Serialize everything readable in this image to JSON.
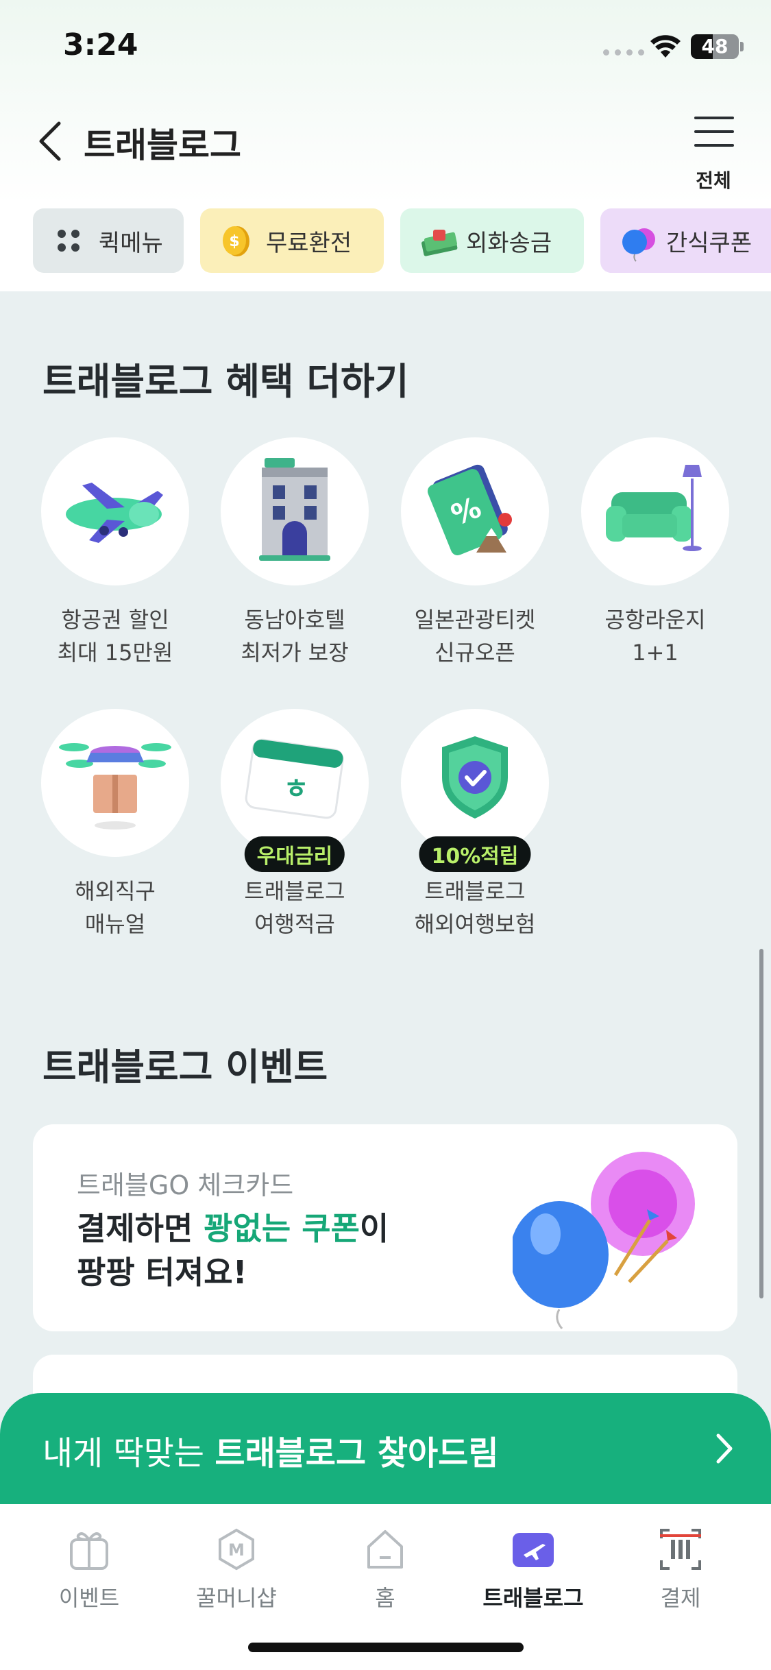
{
  "status_bar": {
    "time": "3:24",
    "battery": "48"
  },
  "header": {
    "title": "트래블로그",
    "menu_label": "전체"
  },
  "quick_menu": [
    {
      "label": "퀵메뉴",
      "icon": "dots-grid-icon"
    },
    {
      "label": "무료환전",
      "icon": "coin-icon"
    },
    {
      "label": "외화송금",
      "icon": "money-stack-icon"
    },
    {
      "label": "간식쿠폰",
      "icon": "balloon-icon"
    }
  ],
  "benefits": {
    "title": "트래블로그 혜택 더하기",
    "items": [
      {
        "line1": "항공권 할인",
        "line2": "최대 15만원",
        "icon": "airplane-icon",
        "badge": ""
      },
      {
        "line1": "동남아호텔",
        "line2": "최저가 보장",
        "icon": "hotel-icon",
        "badge": ""
      },
      {
        "line1": "일본관광티켓",
        "line2": "신규오픈",
        "icon": "ticket-icon",
        "badge": ""
      },
      {
        "line1": "공항라운지",
        "line2": "1+1",
        "icon": "sofa-icon",
        "badge": ""
      },
      {
        "line1": "해외직구",
        "line2": "매뉴얼",
        "icon": "drone-box-icon",
        "badge": ""
      },
      {
        "line1": "트래블로그",
        "line2": "여행적금",
        "icon": "calendar-icon",
        "badge": "우대금리"
      },
      {
        "line1": "트래블로그",
        "line2": "해외여행보험",
        "icon": "shield-icon",
        "badge": "10%적립"
      }
    ]
  },
  "events": {
    "title": "트래블로그 이벤트",
    "card": {
      "subtitle": "트래블GO 체크카드",
      "line1_prefix": "결제하면 ",
      "line1_highlight": "꽝없는 쿠폰",
      "line1_suffix": "이",
      "line2": "팡팡 터져요!"
    }
  },
  "cta": {
    "prefix": "내게 딱맞는 ",
    "bold": "트래블로그 찾아드림"
  },
  "tabbar": [
    {
      "label": "이벤트",
      "icon": "gift-icon",
      "active": false
    },
    {
      "label": "꿀머니샵",
      "icon": "m-badge-icon",
      "active": false
    },
    {
      "label": "홈",
      "icon": "home-icon",
      "active": false
    },
    {
      "label": "트래블로그",
      "icon": "plane-tab-icon",
      "active": true
    },
    {
      "label": "결제",
      "icon": "barcode-scan-icon",
      "active": false
    }
  ],
  "colors": {
    "accent": "#17b07d",
    "highlight": "#16a777",
    "badge_text": "#b9f06a"
  }
}
